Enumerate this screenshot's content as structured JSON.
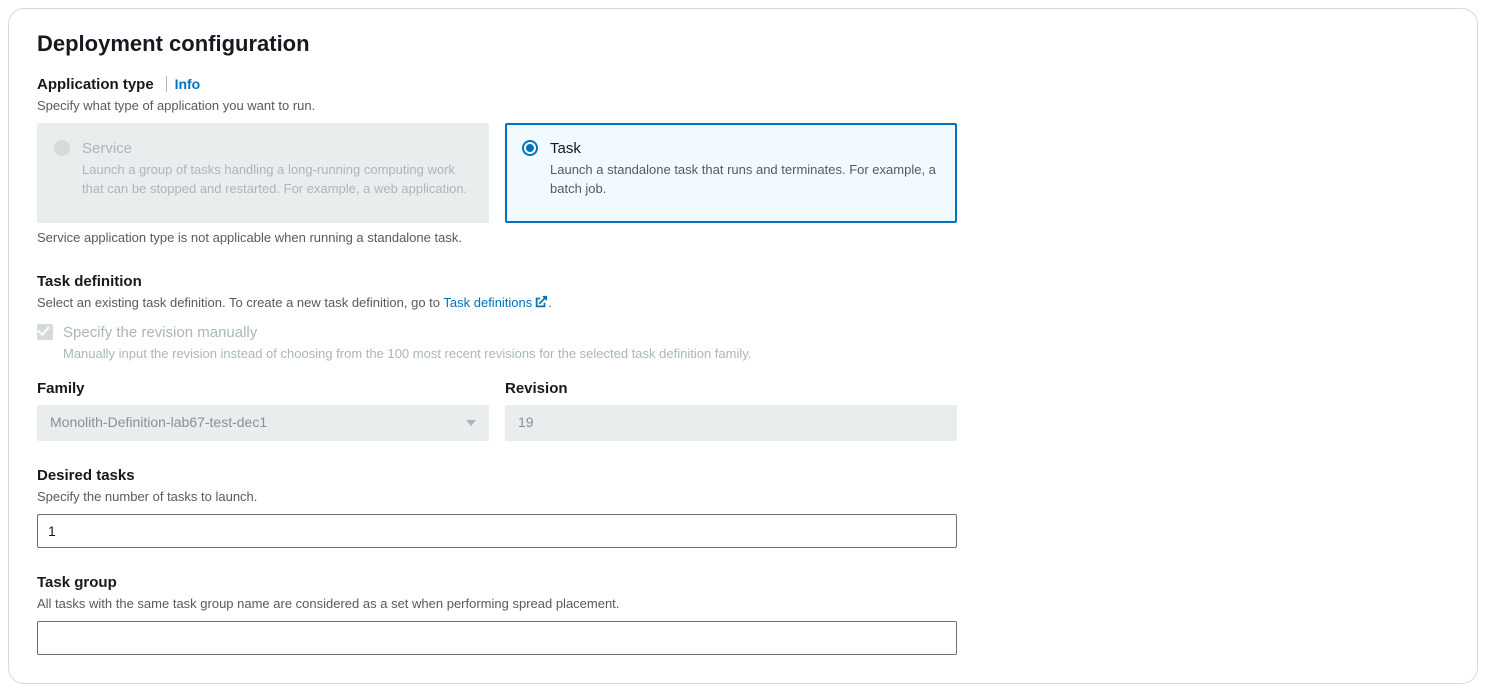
{
  "panel": {
    "title": "Deployment configuration"
  },
  "appType": {
    "label": "Application type",
    "info": "Info",
    "help": "Specify what type of application you want to run.",
    "service": {
      "title": "Service",
      "desc": "Launch a group of tasks handling a long-running computing work that can be stopped and restarted. For example, a web application."
    },
    "task": {
      "title": "Task",
      "desc": "Launch a standalone task that runs and terminates. For example, a batch job."
    },
    "note": "Service application type is not applicable when running a standalone task."
  },
  "taskDef": {
    "label": "Task definition",
    "help_prefix": "Select an existing task definition. To create a new task definition, go to ",
    "link": "Task definitions",
    "help_suffix": ".",
    "checkbox": {
      "label": "Specify the revision manually",
      "help": "Manually input the revision instead of choosing from the 100 most recent revisions for the selected task definition family."
    },
    "family": {
      "label": "Family",
      "value": "Monolith-Definition-lab67-test-dec1"
    },
    "revision": {
      "label": "Revision",
      "value": "19"
    }
  },
  "desiredTasks": {
    "label": "Desired tasks",
    "help": "Specify the number of tasks to launch.",
    "value": "1"
  },
  "taskGroup": {
    "label": "Task group",
    "help": "All tasks with the same task group name are considered as a set when performing spread placement.",
    "value": ""
  }
}
